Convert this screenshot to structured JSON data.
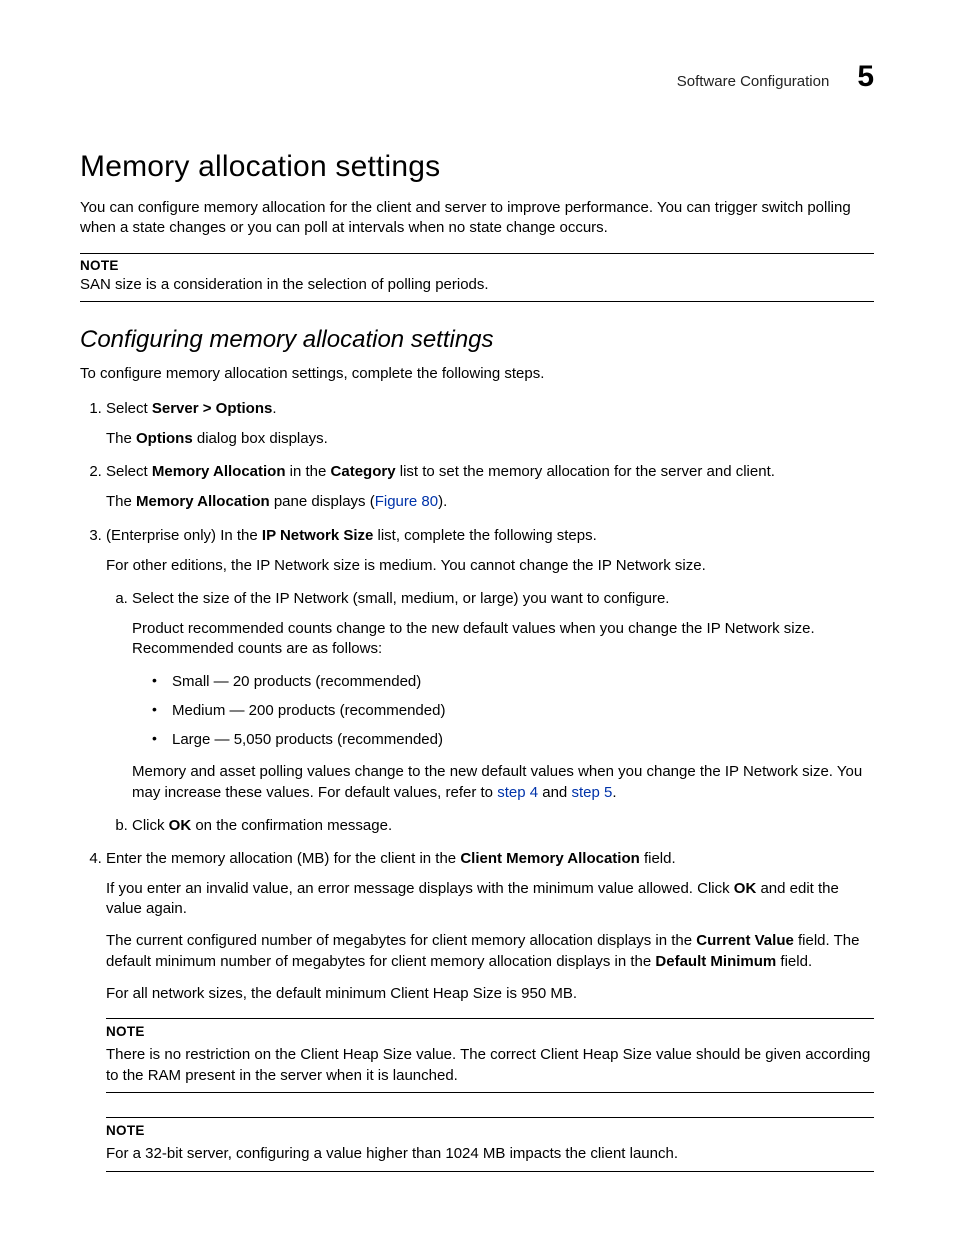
{
  "running_head": {
    "section": "Software Configuration",
    "chapter": "5"
  },
  "h1": "Memory allocation settings",
  "intro": "You can configure memory allocation for the client and server to improve performance. You can trigger switch polling when a state changes or you can poll at intervals when no state change occurs.",
  "note1": {
    "label": "NOTE",
    "body": "SAN size is a consideration in the selection of polling periods."
  },
  "h2": "Configuring memory allocation settings",
  "lead": "To configure memory allocation settings, complete the following steps.",
  "step1": {
    "pre": "Select ",
    "bold": "Server > Options",
    "post": ".",
    "p_pre": "The ",
    "p_bold": "Options",
    "p_post": " dialog box displays."
  },
  "step2": {
    "t1": "Select ",
    "b1": "Memory Allocation",
    "t2": " in the ",
    "b2": "Category",
    "t3": " list to set the memory allocation for the server and client.",
    "p_pre": "The ",
    "p_bold": "Memory Allocation",
    "p_mid": " pane displays (",
    "p_link": "Figure 80",
    "p_post": ")."
  },
  "step3": {
    "t1": "(Enterprise only) In the ",
    "b1": "IP Network Size",
    "t2": " list, complete the following steps.",
    "p1": "For other editions, the IP Network size is medium. You cannot change the IP Network size.",
    "a_text": "Select the size of the IP Network (small, medium, or large) you want to configure.",
    "a_p1": "Product recommended counts change to the new default values when you change the IP Network size. Recommended counts are as follows:",
    "bul1": "Small — 20 products (recommended)",
    "bul2": "Medium — 200 products (recommended)",
    "bul3": "Large — 5,050 products (recommended)",
    "a_p2_pre": "Memory and asset polling values change to the new default values when you change the IP Network size. You may increase these values. For default values, refer to ",
    "a_p2_l1": "step 4",
    "a_p2_mid": " and ",
    "a_p2_l2": "step 5",
    "a_p2_post": ".",
    "b_pre": "Click ",
    "b_bold": "OK",
    "b_post": " on the confirmation message."
  },
  "step4": {
    "t1": "Enter the memory allocation (MB) for the client in the ",
    "b1": "Client Memory Allocation",
    "t2": " field.",
    "p1_pre": "If you enter an invalid value, an error message displays with the minimum value allowed. Click ",
    "p1_b": "OK",
    "p1_post": " and edit the value again.",
    "p2_t1": "The current configured number of megabytes for client memory allocation displays in the ",
    "p2_b1": "Current Value",
    "p2_t2": " field. The default minimum number of megabytes for client memory allocation displays in the ",
    "p2_b2": "Default Minimum",
    "p2_t3": " field.",
    "p3": "For all network sizes, the default minimum Client Heap Size is 950 MB."
  },
  "note2": {
    "label": "NOTE",
    "body": "There is no restriction on the Client Heap Size value. The correct Client Heap Size value should be given according to the RAM present in the server when it is launched."
  },
  "note3": {
    "label": "NOTE",
    "body": "For a 32-bit server, configuring a value higher than 1024 MB impacts the client launch."
  }
}
